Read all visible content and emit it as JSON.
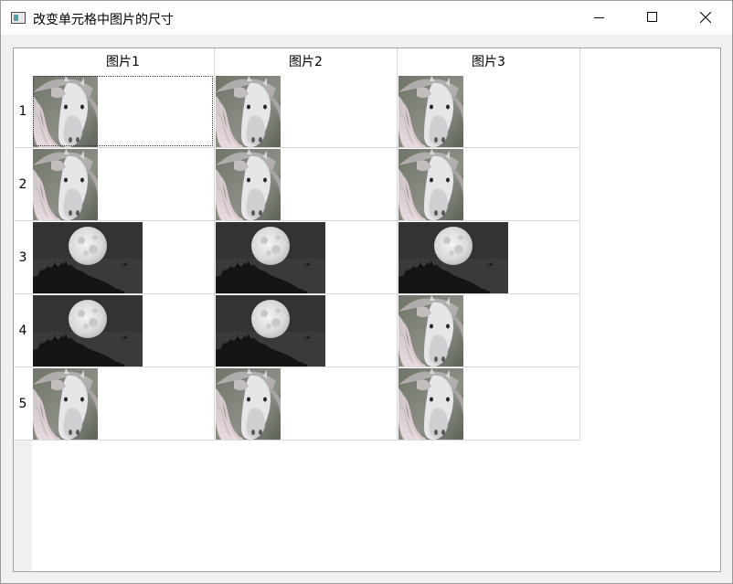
{
  "window": {
    "title": "改变单元格中图片的尺寸",
    "controls": [
      "minimize-icon",
      "maximize-icon",
      "close-icon"
    ]
  },
  "table": {
    "columns": [
      "图片1",
      "图片2",
      "图片3"
    ],
    "rows": [
      "1",
      "2",
      "3",
      "4",
      "5"
    ],
    "cells": [
      [
        "horse",
        "horse",
        "horse"
      ],
      [
        "horse",
        "horse",
        "horse"
      ],
      [
        "moon",
        "moon",
        "moon"
      ],
      [
        "moon",
        "moon",
        "horse"
      ],
      [
        "horse",
        "horse",
        "horse"
      ]
    ],
    "focused_cell": [
      0,
      0
    ]
  }
}
